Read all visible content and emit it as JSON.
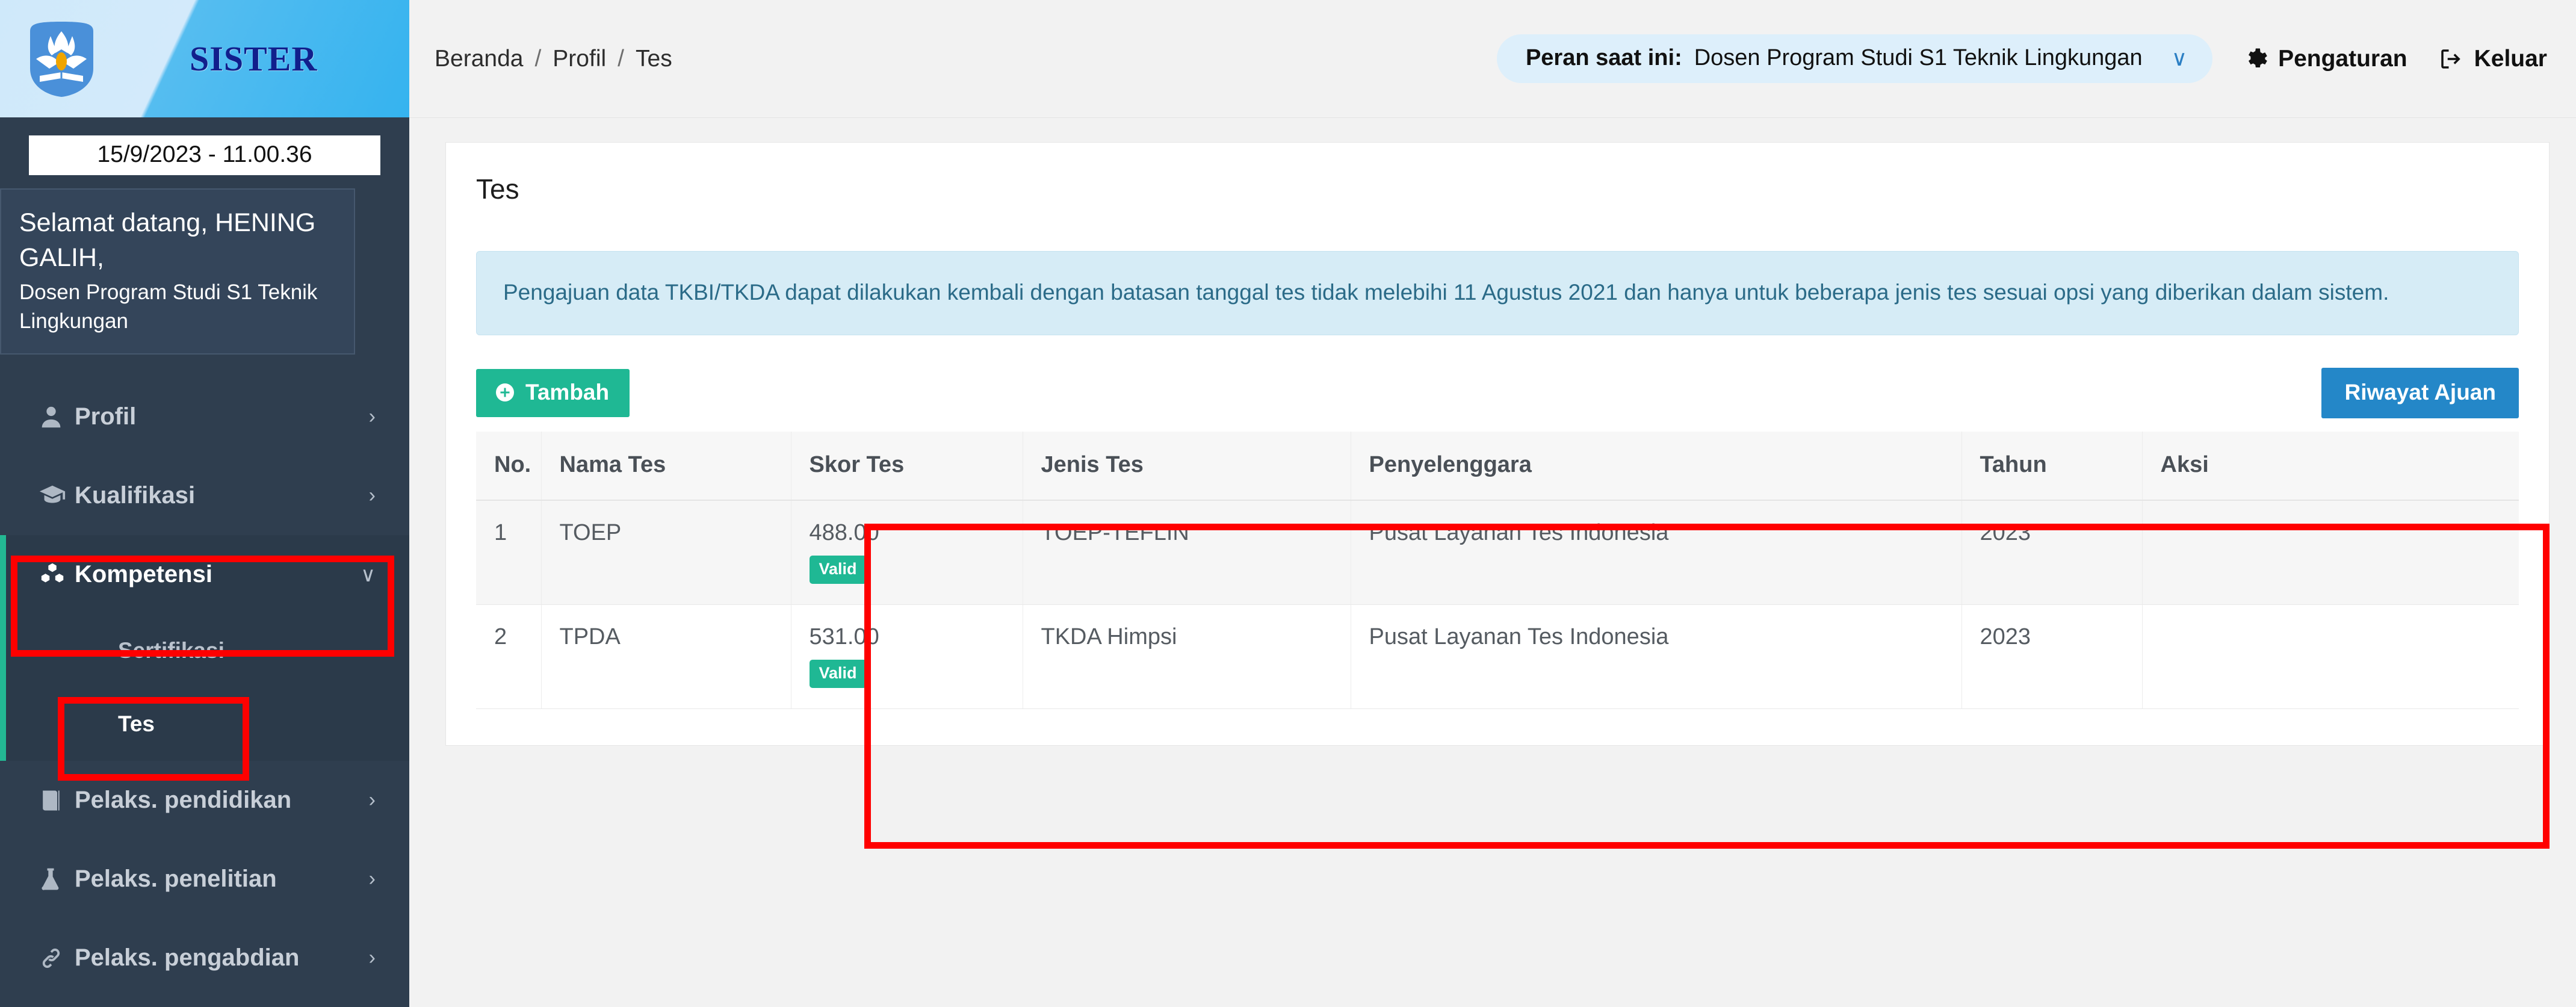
{
  "brand": {
    "name": "SISTER",
    "logo_icon": "kemdikbud-tut-wuri-handayani-logo"
  },
  "sidebar": {
    "clock": "15/9/2023 - 11.00.36",
    "welcome_greeting": "Selamat datang, HENING GALIH,",
    "welcome_role": "Dosen Program Studi S1 Teknik Lingkungan",
    "menu": [
      {
        "label": "Profil",
        "icon": "user-icon",
        "caret": "›"
      },
      {
        "label": "Kualifikasi",
        "icon": "graduation-cap-icon",
        "caret": "›"
      },
      {
        "label": "Kompetensi",
        "icon": "cubes-icon",
        "caret": "∨"
      },
      {
        "label": "Pelaks. pendidikan",
        "icon": "book-icon",
        "caret": "›"
      },
      {
        "label": "Pelaks. penelitian",
        "icon": "flask-icon",
        "caret": "›"
      },
      {
        "label": "Pelaks. pengabdian",
        "icon": "link-icon",
        "caret": "›"
      }
    ],
    "submenu": [
      {
        "label": "Sertifikasi"
      },
      {
        "label": "Tes"
      }
    ]
  },
  "topbar": {
    "breadcrumb": [
      "Beranda",
      "Profil",
      "Tes"
    ],
    "separator": "/",
    "role_label": "Peran saat ini:",
    "role_value": "Dosen Program Studi S1 Teknik Lingkungan",
    "role_caret": "∨",
    "settings_label": "Pengaturan",
    "settings_icon": "gear-icon",
    "logout_label": "Keluar",
    "logout_icon": "sign-out-icon"
  },
  "main": {
    "card_title": "Tes",
    "alert_text": "Pengajuan data TKBI/TKDA dapat dilakukan kembali dengan batasan tanggal tes tidak melebihi 11 Agustus 2021 dan hanya untuk beberapa jenis tes sesuai opsi yang diberikan dalam sistem.",
    "add_button": "Tambah",
    "add_button_icon": "plus-circle-icon",
    "history_button": "Riwayat Ajuan",
    "table": {
      "columns": [
        "No.",
        "Nama Tes",
        "Skor Tes",
        "Jenis Tes",
        "Penyelenggara",
        "Tahun",
        "Aksi"
      ],
      "rows": [
        {
          "no": "1",
          "nama_tes": "TOEP",
          "skor_tes": "488.00",
          "status_badge": "Valid",
          "jenis_tes": "TOEP-TEFLIN",
          "penyelenggara": "Pusat Layanan Tes Indonesia",
          "tahun": "2023",
          "aksi": ""
        },
        {
          "no": "2",
          "nama_tes": "TPDA",
          "skor_tes": "531.00",
          "status_badge": "Valid",
          "jenis_tes": "TKDA Himpsi",
          "penyelenggara": "Pusat Layanan Tes Indonesia",
          "tahun": "2023",
          "aksi": ""
        }
      ]
    }
  },
  "colors": {
    "sidebar_bg": "#2f3e4f",
    "accent_teal": "#23b893",
    "primary_blue": "#2487c8",
    "badge_green": "#1fb894",
    "annotation_red": "#ff0000",
    "alert_bg": "#d6ecf6",
    "alert_text": "#2b6b88"
  }
}
